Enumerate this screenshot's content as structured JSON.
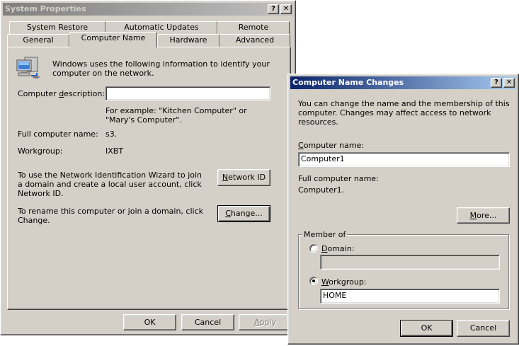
{
  "system_properties": {
    "title": "System Properties",
    "help_btn": "?",
    "close_btn": "✕",
    "tabs_back": [
      "System Restore",
      "Automatic Updates",
      "Remote"
    ],
    "tabs_front": [
      "General",
      "Computer Name",
      "Hardware",
      "Advanced"
    ],
    "intro_text": "Windows uses the following information to identify your computer on the network.",
    "desc_label_pre": "Computer ",
    "desc_label_u": "d",
    "desc_label_post": "escription:",
    "desc_value": "",
    "example_text": "For example: \"Kitchen Computer\" or \"Mary's Computer\".",
    "full_name_label": "Full computer name:",
    "full_name_value": "s3.",
    "workgroup_label": "Workgroup:",
    "workgroup_value": "IXBT",
    "network_text": "To use the Network Identification Wizard to join a domain and create a local user account, click Network ID.",
    "network_btn_u": "N",
    "network_btn_rest": "etwork ID",
    "rename_text": "To rename this computer or join a domain, click Change.",
    "change_btn_u": "C",
    "change_btn_rest": "hange...",
    "ok": "OK",
    "cancel": "Cancel",
    "apply_u": "A",
    "apply_rest": "pply"
  },
  "name_changes": {
    "title": "Computer Name Changes",
    "help_btn": "?",
    "close_btn": "✕",
    "intro_text": "You can change the name and the membership of this computer. Changes may affect access to network resources.",
    "computer_name_label_u": "C",
    "computer_name_label_rest": "omputer name:",
    "computer_name_value": "Computer1",
    "full_name_label": "Full computer name:",
    "full_name_value": "Computer1.",
    "more_btn_u": "M",
    "more_btn_rest": "ore...",
    "member_of": "Member of",
    "domain_label_u": "D",
    "domain_label_rest": "omain:",
    "domain_value": "",
    "workgroup_label_u": "W",
    "workgroup_label_rest": "orkgroup:",
    "workgroup_value": "HOME",
    "selected_membership": "workgroup",
    "ok": "OK",
    "cancel": "Cancel"
  }
}
